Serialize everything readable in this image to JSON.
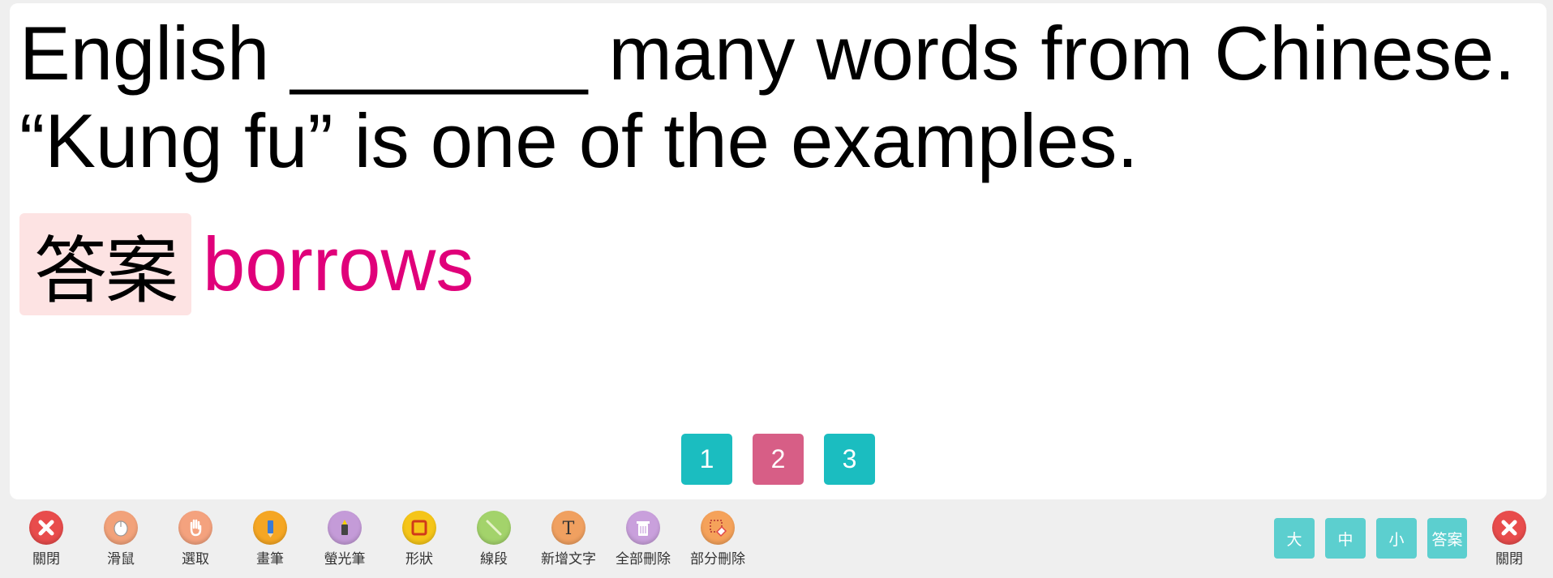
{
  "question": {
    "text": "English _______ many words from Chinese.\n“Kung fu” is one of the examples."
  },
  "answer": {
    "badge_label": "答案",
    "text": "borrows"
  },
  "pager": {
    "pages": [
      {
        "label": "1",
        "color": "#1bbdc0"
      },
      {
        "label": "2",
        "color": "#d75e86"
      },
      {
        "label": "3",
        "color": "#1bbdc0"
      }
    ],
    "current": "2"
  },
  "toolbar": {
    "tools": [
      {
        "icon": "close-icon",
        "label": "關閉",
        "color": "#e84c4c"
      },
      {
        "icon": "mouse-icon",
        "label": "滑鼠",
        "color": "#f2a27a"
      },
      {
        "icon": "hand-icon",
        "label": "選取",
        "color": "#f4a27e"
      },
      {
        "icon": "pen-icon",
        "label": "畫筆",
        "color": "#f5a623"
      },
      {
        "icon": "highlighter-icon",
        "label": "螢光筆",
        "color": "#c49bd8"
      },
      {
        "icon": "shape-icon",
        "label": "形狀",
        "color": "#f5c518"
      },
      {
        "icon": "line-icon",
        "label": "線段",
        "color": "#a3d36b"
      },
      {
        "icon": "text-icon",
        "label": "新增文字",
        "color": "#f0a060"
      },
      {
        "icon": "trash-icon",
        "label": "全部刪除",
        "color": "#c9a0dc"
      },
      {
        "icon": "eraser-icon",
        "label": "部分刪除",
        "color": "#f5a25a"
      }
    ],
    "size_buttons": [
      {
        "label": "大"
      },
      {
        "label": "中"
      },
      {
        "label": "小"
      },
      {
        "label": "答案"
      }
    ],
    "close_right": {
      "icon": "close-icon",
      "label": "關閉",
      "color": "#e84c4c"
    }
  }
}
